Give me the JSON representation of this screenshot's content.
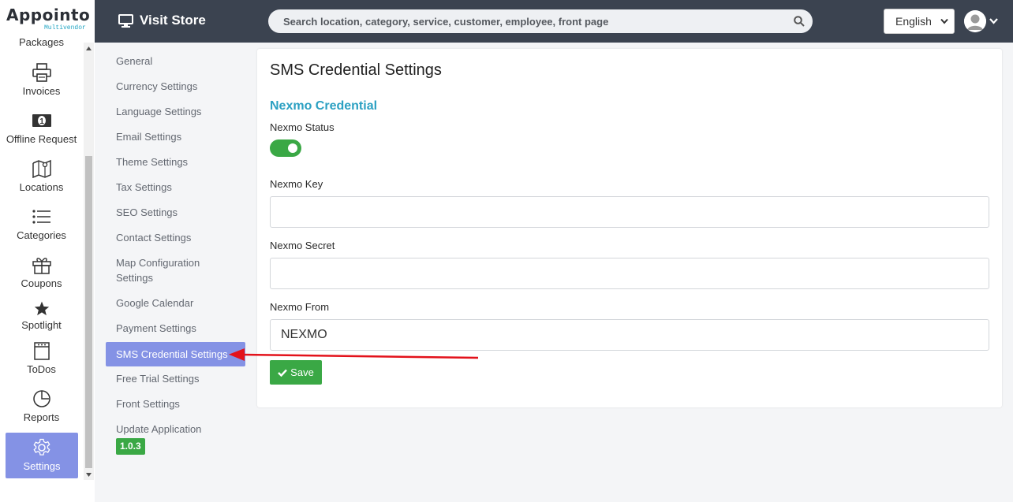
{
  "brand": {
    "name": "Appointo",
    "tagline": "Multivendor"
  },
  "topbar": {
    "visit_store": "Visit Store",
    "search_placeholder": "Search location, category, service, customer, employee, front page",
    "language": "English"
  },
  "left_nav": {
    "items": [
      {
        "label": "Packages",
        "icon": "package-icon"
      },
      {
        "label": "Invoices",
        "icon": "printer-icon"
      },
      {
        "label": "Offline Request",
        "icon": "money-icon"
      },
      {
        "label": "Locations",
        "icon": "map-icon"
      },
      {
        "label": "Categories",
        "icon": "list-icon"
      },
      {
        "label": "Coupons",
        "icon": "gift-icon"
      },
      {
        "label": "Spotlight",
        "icon": "star-icon"
      },
      {
        "label": "ToDos",
        "icon": "notepad-icon"
      },
      {
        "label": "Reports",
        "icon": "pie-chart-icon"
      },
      {
        "label": "Settings",
        "icon": "gear-icon",
        "active": true
      }
    ]
  },
  "settings_menu": {
    "items": [
      "General",
      "Currency Settings",
      "Language Settings",
      "Email Settings",
      "Theme Settings",
      "Tax Settings",
      "SEO Settings",
      "Contact Settings",
      "Map Configuration Settings",
      "Google Calendar",
      "Payment Settings",
      "SMS Credential Settings",
      "Free Trial Settings",
      "Front Settings",
      "Update Application"
    ],
    "active": "SMS Credential Settings",
    "version": "1.0.3"
  },
  "main": {
    "title": "SMS Credential Settings",
    "section_title": "Nexmo Credential",
    "status_label": "Nexmo Status",
    "status_on": true,
    "key_label": "Nexmo Key",
    "key_value": "",
    "secret_label": "Nexmo Secret",
    "secret_value": "",
    "from_label": "Nexmo From",
    "from_value": "NEXMO",
    "save_label": "Save"
  },
  "colors": {
    "topbar": "#3b4350",
    "accent_active": "#8492e5",
    "success": "#3aa845",
    "section_title": "#2ba0c2",
    "annotation_arrow": "#e3121b"
  }
}
